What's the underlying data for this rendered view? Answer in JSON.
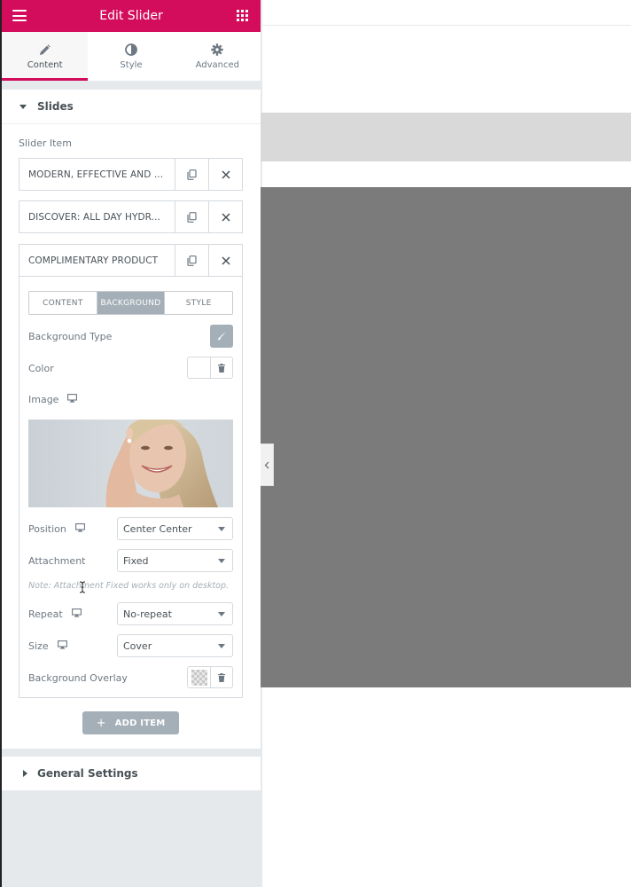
{
  "header": {
    "title": "Edit Slider"
  },
  "tabs": [
    {
      "label": "Content",
      "icon": "pencil-icon",
      "active": true
    },
    {
      "label": "Style",
      "icon": "half-circle-icon",
      "active": false
    },
    {
      "label": "Advanced",
      "icon": "gear-icon",
      "active": false
    }
  ],
  "slides_section": {
    "title": "Slides",
    "list_label": "Slider Item"
  },
  "items": [
    {
      "label": "MODERN, EFFECTIVE AND ..."
    },
    {
      "label": "DISCOVER: ALL DAY HYDR..."
    },
    {
      "label": "COMPLIMENTARY PRODUCT"
    }
  ],
  "item_tabs": [
    {
      "label": "CONTENT",
      "active": false
    },
    {
      "label": "BACKGROUND",
      "active": true
    },
    {
      "label": "STYLE",
      "active": false
    }
  ],
  "background": {
    "type_label": "Background Type",
    "color_label": "Color",
    "image_label": "Image",
    "position_label": "Position",
    "position_value": "Center Center",
    "attachment_label": "Attachment",
    "attachment_value": "Fixed",
    "note": "Note: Attachment Fixed works only on desktop.",
    "repeat_label": "Repeat",
    "repeat_value": "No-repeat",
    "size_label": "Size",
    "size_value": "Cover",
    "overlay_label": "Background Overlay"
  },
  "add_item_label": "ADD ITEM",
  "general_section": {
    "title": "General Settings"
  },
  "colors": {
    "brand": "#d30c5c",
    "panel_bg": "#e6e9ec",
    "preview_slide": "#7b7b7b"
  }
}
